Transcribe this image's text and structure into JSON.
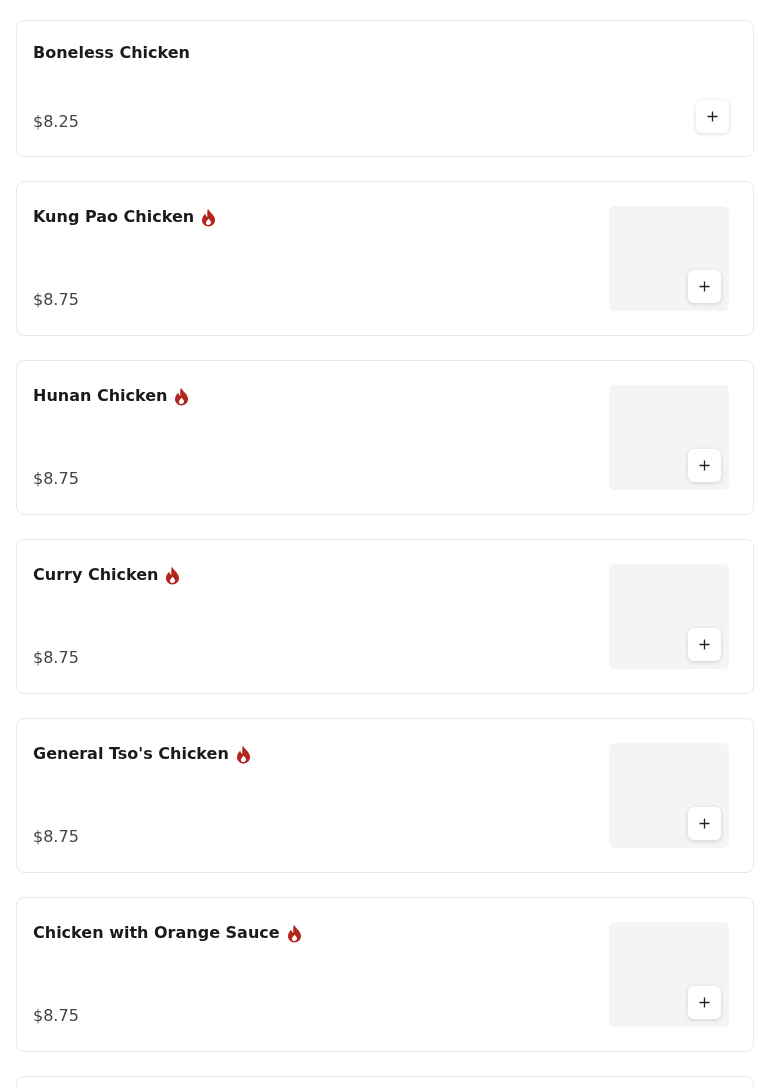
{
  "menu_items": [
    {
      "name": "Boneless Chicken",
      "spicy": false,
      "price": "$8.25",
      "has_image": false
    },
    {
      "name": "Kung Pao Chicken",
      "spicy": true,
      "price": "$8.75",
      "has_image": true
    },
    {
      "name": "Hunan Chicken",
      "spicy": true,
      "price": "$8.75",
      "has_image": true
    },
    {
      "name": "Curry Chicken",
      "spicy": true,
      "price": "$8.75",
      "has_image": true
    },
    {
      "name": "General Tso's Chicken",
      "spicy": true,
      "price": "$8.75",
      "has_image": true
    },
    {
      "name": "Chicken with Orange Sauce",
      "spicy": true,
      "price": "$8.75",
      "has_image": true
    }
  ],
  "more_below": true
}
